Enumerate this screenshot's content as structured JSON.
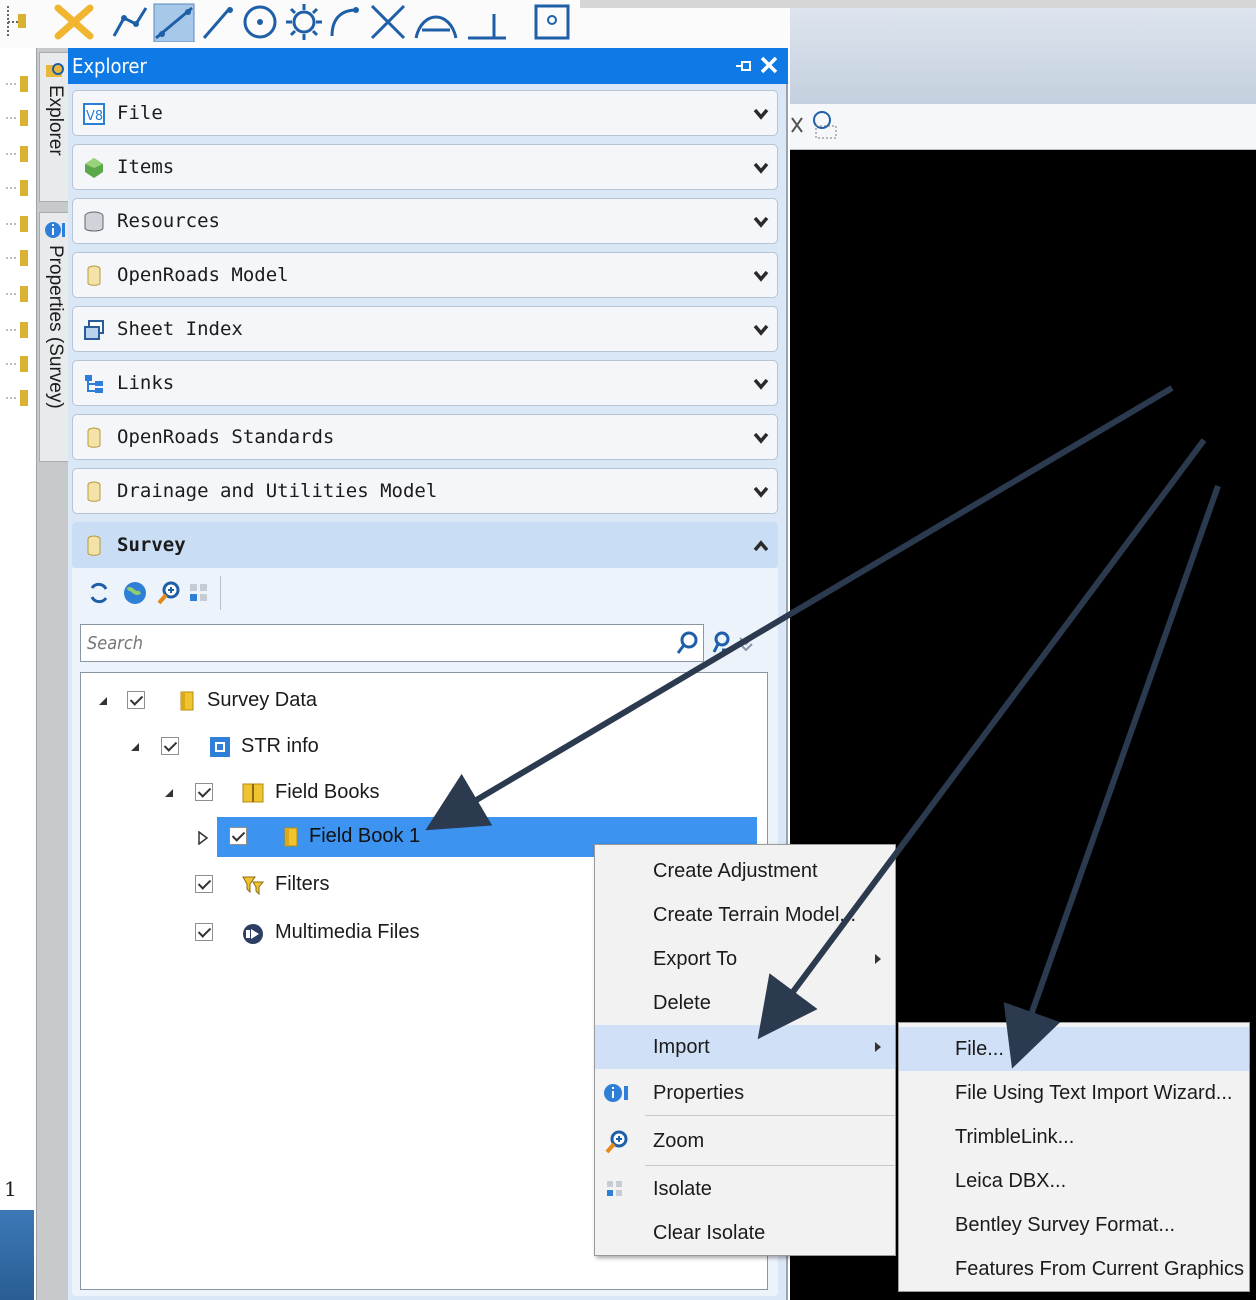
{
  "explorer": {
    "title": "Explorer",
    "sections": [
      {
        "label": "File",
        "icon": "v8-file-icon"
      },
      {
        "label": "Items",
        "icon": "items-gem-icon"
      },
      {
        "label": "Resources",
        "icon": "database-icon"
      },
      {
        "label": "OpenRoads Model",
        "icon": "cylinder-icon"
      },
      {
        "label": "Sheet Index",
        "icon": "sheet-index-icon"
      },
      {
        "label": "Links",
        "icon": "links-tree-icon"
      },
      {
        "label": "OpenRoads Standards",
        "icon": "cylinder-icon"
      },
      {
        "label": "Drainage and Utilities Model",
        "icon": "cylinder-icon"
      }
    ],
    "open_section": {
      "label": "Survey",
      "icon": "cylinder-icon"
    }
  },
  "vertical_tabs": {
    "explorer": "Explorer",
    "properties": "Properties (Survey)"
  },
  "survey": {
    "search_placeholder": "Search",
    "tree": [
      {
        "label": "Survey Data",
        "level": 0,
        "expanded": true,
        "icon": "folder-yellow-icon"
      },
      {
        "label": "STR info",
        "level": 1,
        "expanded": true,
        "icon": "str-info-icon"
      },
      {
        "label": "Field Books",
        "level": 2,
        "expanded": true,
        "icon": "field-books-icon"
      },
      {
        "label": "Field Book 1",
        "level": 3,
        "expanded": false,
        "selected": true,
        "icon": "field-book-icon"
      },
      {
        "label": "Filters",
        "level": 2,
        "icon": "filter-icon"
      },
      {
        "label": "Multimedia Files",
        "level": 2,
        "icon": "multimedia-icon"
      }
    ]
  },
  "context_menu": {
    "items": [
      {
        "label": "Create Adjustment"
      },
      {
        "label": "Create Terrain Model..."
      },
      {
        "label": "Export To",
        "submenu": true
      },
      {
        "label": "Delete"
      },
      {
        "label": "Import",
        "submenu": true,
        "highlighted": true
      },
      {
        "label": "Properties",
        "icon": "properties-icon"
      },
      {
        "label": "Zoom",
        "icon": "zoom-icon"
      },
      {
        "label": "Isolate",
        "icon": "isolate-icon"
      },
      {
        "label": "Clear Isolate"
      }
    ]
  },
  "import_submenu": {
    "items": [
      {
        "label": "File...",
        "highlighted": true
      },
      {
        "label": "File Using Text Import Wizard..."
      },
      {
        "label": "TrimbleLink..."
      },
      {
        "label": "Leica DBX..."
      },
      {
        "label": "Bentley Survey Format..."
      },
      {
        "label": "Features From Current Graphics"
      }
    ]
  },
  "gutter_number": "1",
  "colors": {
    "title_blue": "#0f7ae6",
    "selection_blue": "#3c93f0",
    "menu_highlight": "#cfe0f7",
    "arrow": "#2b3a4f"
  }
}
